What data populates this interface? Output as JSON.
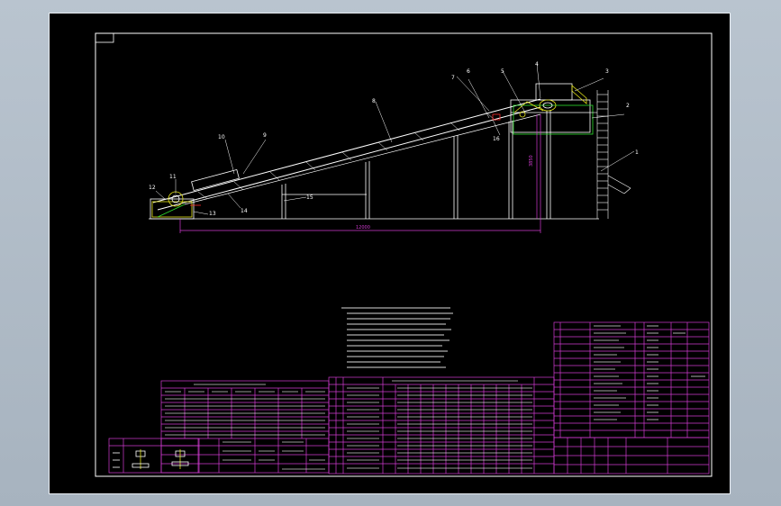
{
  "drawing": {
    "part_labels": [
      "1",
      "2",
      "3",
      "4",
      "5",
      "6",
      "7",
      "8",
      "9",
      "10",
      "11",
      "12",
      "13",
      "14",
      "15",
      "16"
    ],
    "dimensions": {
      "horizontal_length": "12000",
      "vertical_height": "3850"
    }
  },
  "colors": {
    "canvas": "#000000",
    "structure": "#ffffff",
    "table": "#d23bd2",
    "accent_yellow": "#e4e41a",
    "accent_green": "#2de12d",
    "accent_red": "#ff2a2a",
    "window_bg": "#b9c4cf"
  }
}
